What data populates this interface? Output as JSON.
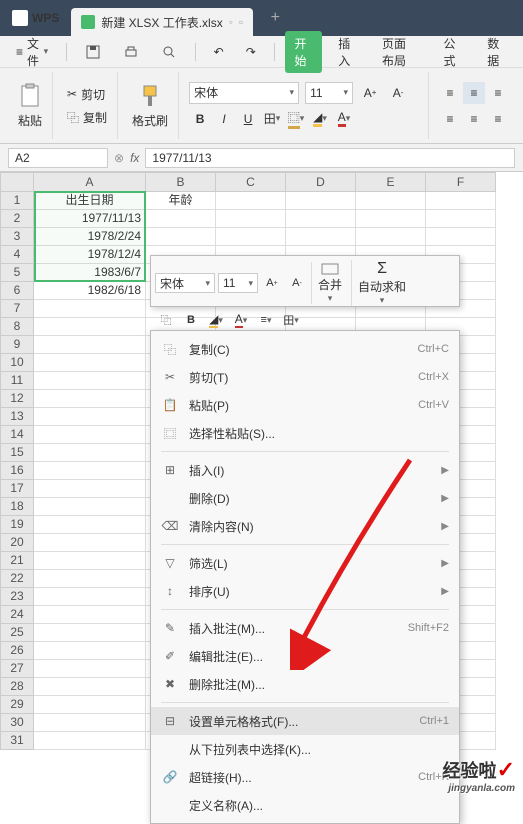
{
  "title_bar": {
    "wps_label": "WPS",
    "tab_label": "新建 XLSX 工作表.xlsx"
  },
  "menu": {
    "file": "文件"
  },
  "ribbon": {
    "start": "开始",
    "insert": "插入",
    "page_layout": "页面布局",
    "formula": "公式",
    "data": "数据"
  },
  "toolbar": {
    "paste": "粘贴",
    "cut": "剪切",
    "copy": "复制",
    "format_painter": "格式刷",
    "font_name": "宋体",
    "font_size": "11",
    "bold": "B",
    "italic": "I",
    "underline": "U",
    "strike": "A"
  },
  "name_box": "A2",
  "fx": "fx",
  "formula_value": "1977/11/13",
  "columns": [
    "A",
    "B",
    "C",
    "D",
    "E",
    "F"
  ],
  "rows_count": 31,
  "headers": {
    "a": "出生日期",
    "b": "年龄"
  },
  "data_rows": [
    "1977/11/13",
    "1978/2/24",
    "1978/12/4",
    "1983/6/7",
    "1982/6/18"
  ],
  "mini": {
    "font": "宋体",
    "size": "11",
    "merge": "合并",
    "autosum": "自动求和",
    "bold": "B"
  },
  "context": [
    {
      "icon": "copy",
      "label": "复制(C)",
      "shortcut": "Ctrl+C"
    },
    {
      "icon": "cut",
      "label": "剪切(T)",
      "shortcut": "Ctrl+X"
    },
    {
      "icon": "paste",
      "label": "粘贴(P)",
      "shortcut": "Ctrl+V"
    },
    {
      "icon": "paste-special",
      "label": "选择性粘贴(S)...",
      "shortcut": ""
    },
    {
      "sep": true
    },
    {
      "icon": "insert",
      "label": "插入(I)",
      "arrow": true
    },
    {
      "icon": "",
      "label": "删除(D)",
      "arrow": true
    },
    {
      "icon": "clear",
      "label": "清除内容(N)",
      "arrow": true
    },
    {
      "sep": true
    },
    {
      "icon": "filter",
      "label": "筛选(L)",
      "arrow": true
    },
    {
      "icon": "sort",
      "label": "排序(U)",
      "arrow": true
    },
    {
      "sep": true
    },
    {
      "icon": "comment",
      "label": "插入批注(M)...",
      "shortcut": "Shift+F2"
    },
    {
      "icon": "edit-comment",
      "label": "编辑批注(E)...",
      "disabled": true
    },
    {
      "icon": "del-comment",
      "label": "删除批注(M)...",
      "disabled": true
    },
    {
      "sep": true
    },
    {
      "icon": "format-cells",
      "label": "设置单元格格式(F)...",
      "shortcut": "Ctrl+1",
      "hover": true
    },
    {
      "icon": "",
      "label": "从下拉列表中选择(K)...",
      "shortcut": ""
    },
    {
      "icon": "link",
      "label": "超链接(H)...",
      "shortcut": "Ctrl+K"
    },
    {
      "icon": "",
      "label": "定义名称(A)...",
      "shortcut": ""
    }
  ],
  "watermark": {
    "cn": "经验啦",
    "en": "jingyanla.com"
  }
}
